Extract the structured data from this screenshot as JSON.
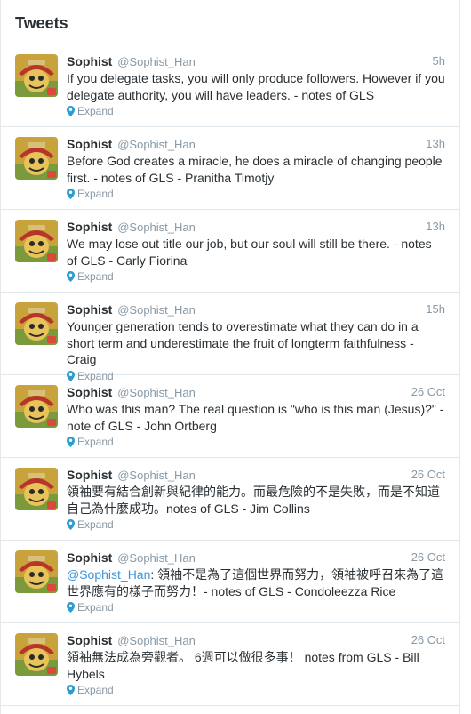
{
  "header": {
    "title": "Tweets"
  },
  "tweets": [
    {
      "name": "Sophist",
      "handle": "@Sophist_Han",
      "time": "5h",
      "mention": "",
      "text": "If you delegate tasks, you will only produce followers. However if you delegate authority, you will have leaders. - notes of GLS",
      "expand": "Expand"
    },
    {
      "name": "Sophist",
      "handle": "@Sophist_Han",
      "time": "13h",
      "mention": "",
      "text": "Before God creates a miracle, he does a miracle of changing people first. - notes of GLS - Pranitha Timotjy",
      "expand": "Expand"
    },
    {
      "name": "Sophist",
      "handle": "@Sophist_Han",
      "time": "13h",
      "mention": "",
      "text": "We may lose out title our job, but our soul will still be there. - notes of GLS - Carly Fiorina",
      "expand": "Expand"
    },
    {
      "name": "Sophist",
      "handle": "@Sophist_Han",
      "time": "15h",
      "mention": "",
      "text": "Younger generation tends to overestimate what they can do in a short term and underestimate the fruit of longterm faithfulness - Craig",
      "expand": "Expand"
    },
    {
      "name": "Sophist",
      "handle": "@Sophist_Han",
      "time": "26 Oct",
      "mention": "",
      "text": "Who was this man? The real question is \"who is this man (Jesus)?\" - note of GLS - John Ortberg",
      "expand": "Expand"
    },
    {
      "name": "Sophist",
      "handle": "@Sophist_Han",
      "time": "26 Oct",
      "mention": "",
      "text": "領袖要有結合創新與紀律的能力。而最危險的不是失敗，而是不知道自己為什麼成功。notes of GLS - Jim Collins",
      "expand": "Expand"
    },
    {
      "name": "Sophist",
      "handle": "@Sophist_Han",
      "time": "26 Oct",
      "mention": "@Sophist_Han",
      "text": ": 領袖不是為了這個世界而努力，領袖被呼召來為了這世界應有的樣子而努力！- notes of GLS - Condoleezza Rice",
      "expand": "Expand"
    },
    {
      "name": "Sophist",
      "handle": "@Sophist_Han",
      "time": "26 Oct",
      "mention": "",
      "text": "領袖無法成為旁觀者。 6週可以做很多事！ notes from GLS - Bill Hybels",
      "expand": "Expand"
    }
  ],
  "colors": {
    "link": "#3b94d9",
    "muted": "#8899a6",
    "text": "#292f33",
    "pin": "#2b9cd2"
  }
}
